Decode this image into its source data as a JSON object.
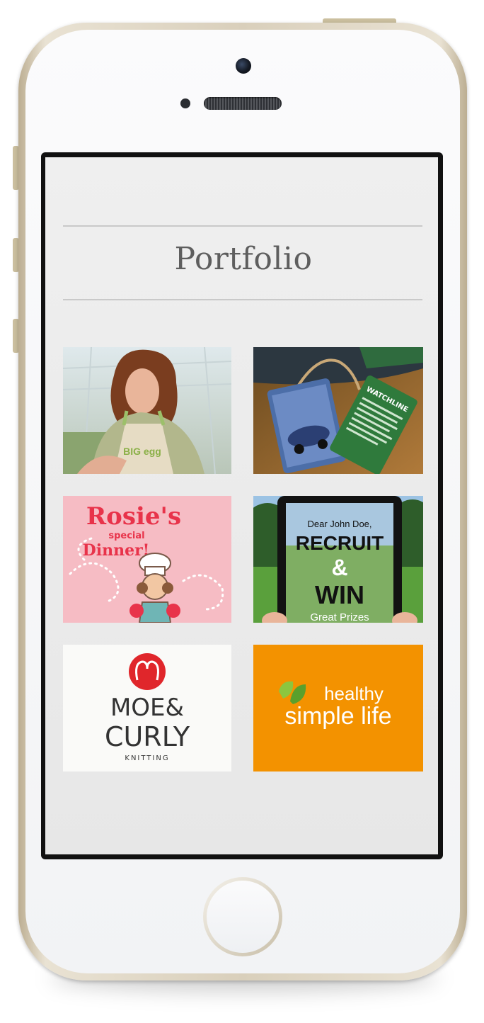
{
  "page": {
    "title": "Portfolio"
  },
  "portfolio": {
    "items": [
      {
        "name": "big-egg-gardener",
        "logo_text": "BIG egg"
      },
      {
        "name": "watchline-tag",
        "tag_text": "WATCHLINE"
      },
      {
        "name": "rosies-special-dinner",
        "line1": "Rosie's",
        "line2": "special",
        "line3": "Dinner!"
      },
      {
        "name": "recruit-and-win",
        "line1": "Dear John Doe,",
        "line2": "RECRUIT",
        "line3": "&",
        "line4": "WIN",
        "line5": "Great Prizes"
      },
      {
        "name": "moe-and-curly",
        "line1": "MOE&",
        "line2": "CURLY",
        "line3": "KNITTING"
      },
      {
        "name": "healthy-simple-life",
        "line1": "healthy",
        "line2": "simple life"
      }
    ]
  },
  "colors": {
    "accent_orange": "#f39200",
    "rosie_pink": "#f6bcc4",
    "rosie_red": "#e8334a",
    "moe_red": "#e0262b"
  }
}
